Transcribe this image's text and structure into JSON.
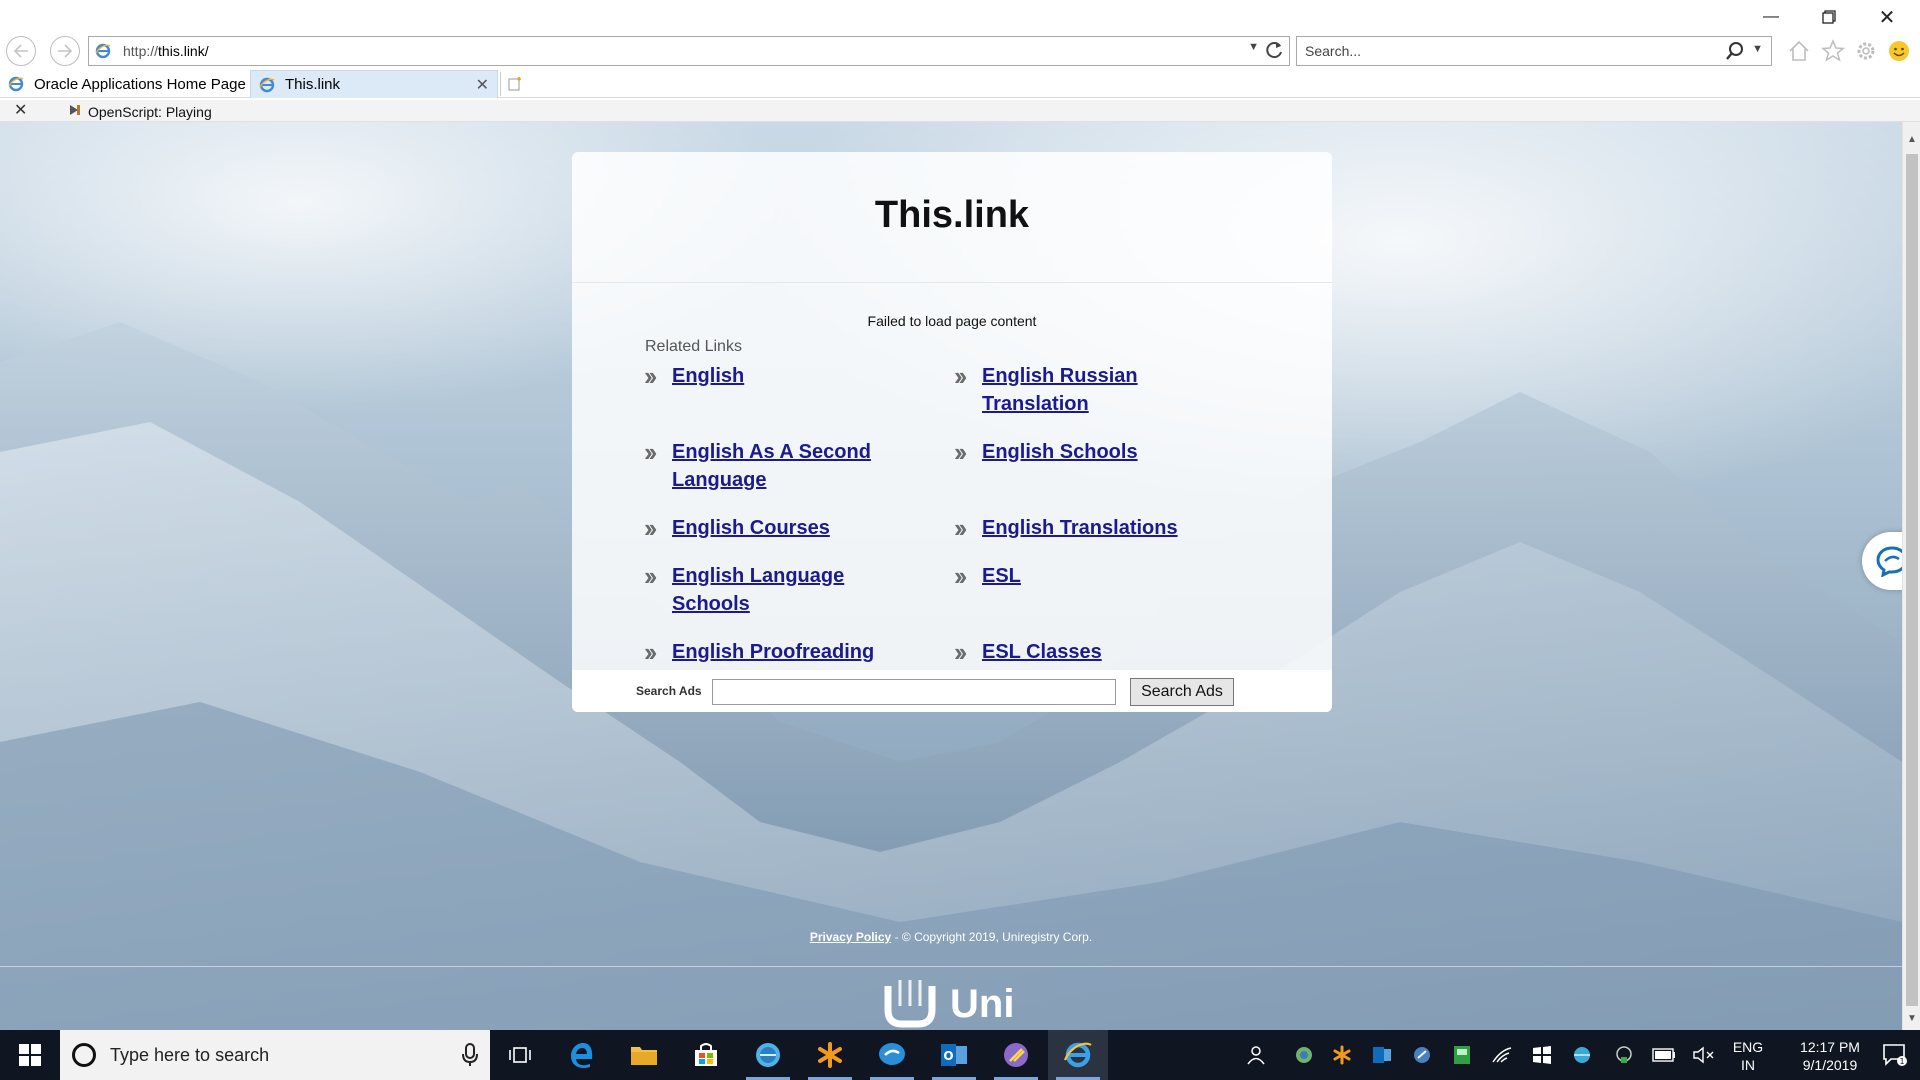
{
  "browser": {
    "url_prefix": "http://",
    "url_host": "this.link/",
    "search_placeholder": "Search...",
    "tabs": [
      {
        "label": "Oracle Applications Home Page",
        "active": false
      },
      {
        "label": "This.link",
        "active": true
      }
    ],
    "notification": "OpenScript: Playing"
  },
  "page": {
    "site_name": "This.link",
    "fail_message": "Failed to load page content",
    "related_header": "Related Links",
    "links_left": [
      {
        "line1": "English",
        "line2": ""
      },
      {
        "line1": "English As A Second",
        "line2": "Language"
      },
      {
        "line1": "English Courses",
        "line2": ""
      },
      {
        "line1": "English Language",
        "line2": "Schools"
      },
      {
        "line1": "English Proofreading",
        "line2": ""
      }
    ],
    "links_right": [
      {
        "line1": "English Russian",
        "line2": "Translation"
      },
      {
        "line1": "English Schools",
        "line2": ""
      },
      {
        "line1": "English Translations",
        "line2": ""
      },
      {
        "line1": "ESL",
        "line2": ""
      },
      {
        "line1": "ESL Classes",
        "line2": ""
      }
    ],
    "ads_label": "Search Ads",
    "ads_button": "Search Ads",
    "privacy_link": "Privacy Policy",
    "copyright": " - © Copyright 2019, Uniregistry Corp.",
    "logo_text": "Uni"
  },
  "taskbar": {
    "search_placeholder": "Type here to search",
    "lang_line1": "ENG",
    "lang_line2": "IN",
    "time": "12:17 PM",
    "date": "9/1/2019",
    "notification_count": "1"
  },
  "colors": {
    "link": "#1b1a8f",
    "taskbar": "#0f1521",
    "active_tab": "#dce9f7"
  }
}
